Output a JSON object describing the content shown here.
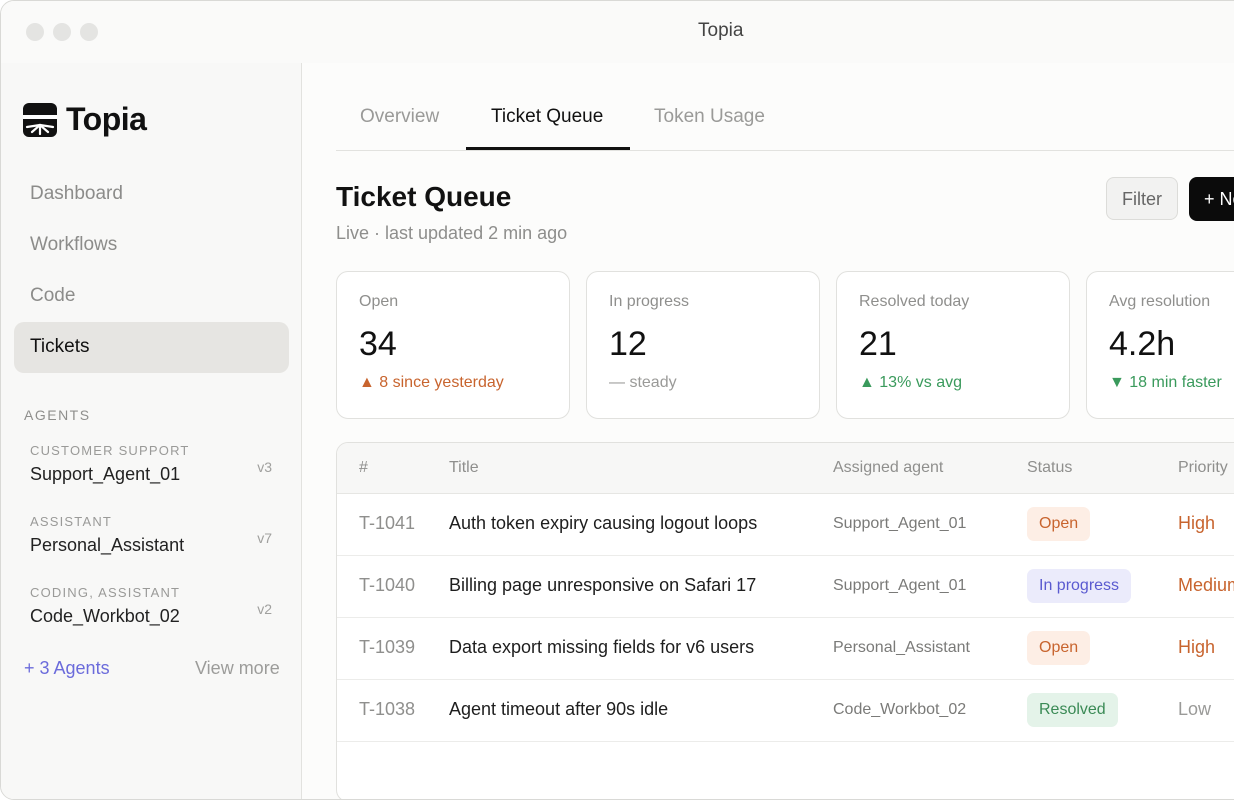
{
  "window": {
    "title": "Topia"
  },
  "brand": {
    "name": "Topia"
  },
  "sidebar": {
    "nav": [
      {
        "label": "Dashboard"
      },
      {
        "label": "Workflows"
      },
      {
        "label": "Code"
      },
      {
        "label": "Tickets",
        "active": true
      }
    ],
    "section_label": "AGENTS",
    "agents": [
      {
        "tag": "CUSTOMER SUPPORT",
        "name": "Support_Agent_01",
        "version": "v3"
      },
      {
        "tag": "ASSISTANT",
        "name": "Personal_Assistant",
        "version": "v7"
      },
      {
        "tag": "CODING, ASSISTANT",
        "name": "Code_Workbot_02",
        "version": "v2"
      }
    ],
    "more_agents": "+ 3 Agents",
    "view_more": "View more"
  },
  "tabs": [
    {
      "label": "Overview"
    },
    {
      "label": "Ticket Queue",
      "active": true
    },
    {
      "label": "Token Usage"
    }
  ],
  "page": {
    "title": "Ticket Queue",
    "subtitle": "Live · last updated 2 min ago",
    "filter_label": "Filter",
    "new_label": "+ New"
  },
  "stats": [
    {
      "label": "Open",
      "value": "34",
      "delta": "▲ 8 since yesterday",
      "tone": "warn"
    },
    {
      "label": "In progress",
      "value": "12",
      "delta": "— steady",
      "tone": "neutral"
    },
    {
      "label": "Resolved today",
      "value": "21",
      "delta": "▲ 13% vs avg",
      "tone": "good"
    },
    {
      "label": "Avg resolution",
      "value": "4.2h",
      "delta": "▼ 18 min faster",
      "tone": "good"
    }
  ],
  "table": {
    "headers": {
      "id": "#",
      "title": "Title",
      "agent": "Assigned agent",
      "status": "Status",
      "priority": "Priority"
    },
    "rows": [
      {
        "id": "T-1041",
        "title": "Auth token expiry causing logout loops",
        "agent": "Support_Agent_01",
        "status": "Open",
        "priority": "High"
      },
      {
        "id": "T-1040",
        "title": "Billing page unresponsive on Safari 17",
        "agent": "Support_Agent_01",
        "status": "In progress",
        "priority": "Medium"
      },
      {
        "id": "T-1039",
        "title": "Data export missing fields for v6 users",
        "agent": "Personal_Assistant",
        "status": "Open",
        "priority": "High"
      },
      {
        "id": "T-1038",
        "title": "Agent timeout after 90s idle",
        "agent": "Code_Workbot_02",
        "status": "Resolved",
        "priority": "Low"
      }
    ]
  },
  "colors": {
    "accent_warn": "#c8642e",
    "accent_good": "#3a9a5c",
    "accent_link": "#6b6bdb",
    "primary_button": "#0b0b0b"
  }
}
